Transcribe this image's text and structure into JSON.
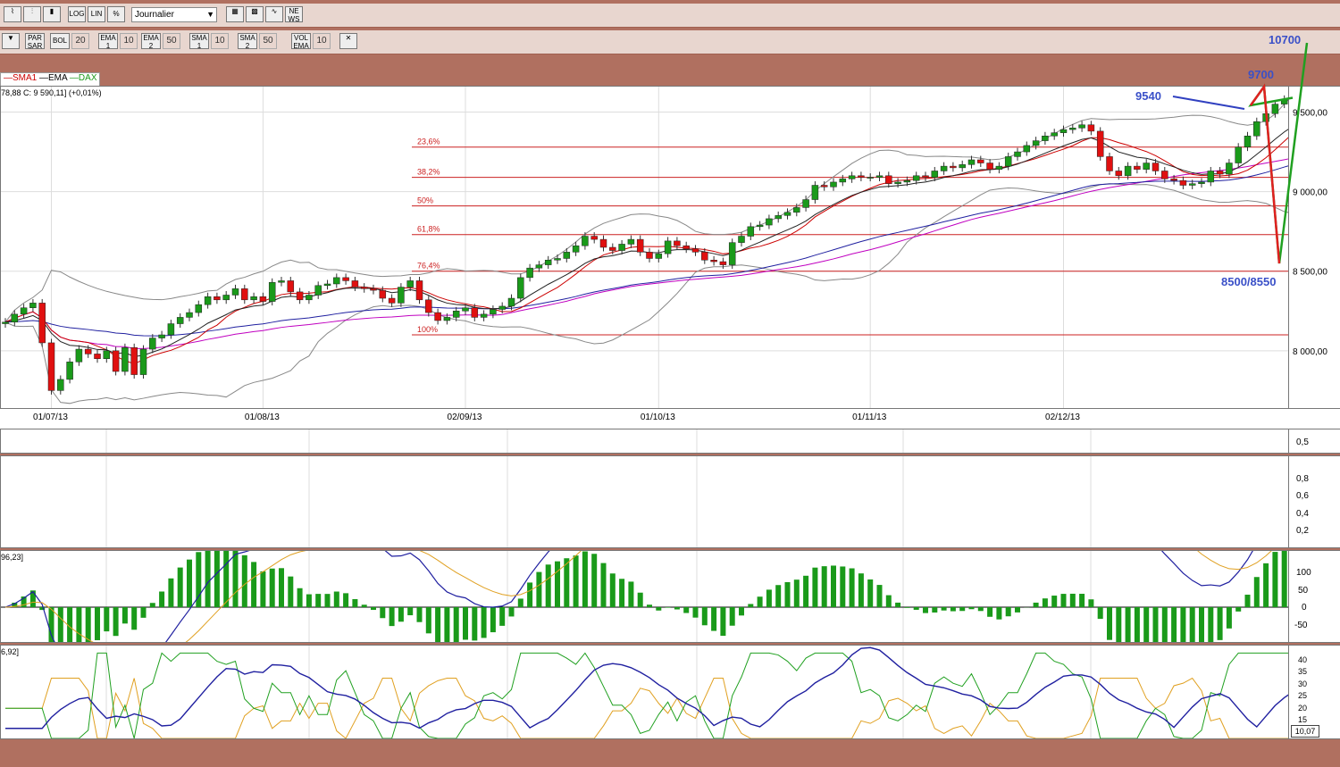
{
  "toolbar": {
    "period": "Journalier",
    "btn_log": "LOG",
    "btn_lin": "LIN",
    "btn_pct": "%",
    "btn_parsar": "PAR SAR",
    "btn_bol": "BOL",
    "bol_period": "20",
    "btn_ema1": "EMA 1",
    "ema1_period": "10",
    "btn_ema2": "EMA 2",
    "ema2_period": "50",
    "btn_sma1": "SMA 1",
    "sma1_period": "10",
    "btn_sma2": "SMA 2",
    "sma2_period": "50",
    "btn_vol": "VOL EMA",
    "vol_period": "10",
    "btn_news": "NE WS"
  },
  "legend": {
    "sma": "SMA1",
    "ema": "EMA",
    "dax": "DAX"
  },
  "info": "78,88  C: 9 590,11] (+0,01%)",
  "panel3_label": "96,23]",
  "panel4_label": "6,92]",
  "last_value": "10,07",
  "colors": {
    "up": "#1a9a1a",
    "down": "#e01010",
    "bg": "#b07060",
    "fib": "#cc2020",
    "ema": "#2020a0",
    "sma": "#c000c0"
  },
  "chart_data": {
    "type": "candlestick",
    "series_name": "DAX",
    "x_ticks": [
      {
        "label": "01/07/13",
        "day": 5
      },
      {
        "label": "01/08/13",
        "day": 28
      },
      {
        "label": "02/09/13",
        "day": 50
      },
      {
        "label": "01/10/13",
        "day": 71
      },
      {
        "label": "01/11/13",
        "day": 94
      },
      {
        "label": "02/12/13",
        "day": 115
      }
    ],
    "y_ticks": [
      {
        "label": "8 000,00",
        "value": 8000
      },
      {
        "label": "8 500,00",
        "value": 8500
      },
      {
        "label": "9 000,00",
        "value": 9000
      },
      {
        "label": "9 500,00",
        "value": 9500
      }
    ],
    "ylim": [
      7640,
      9660
    ],
    "fib_levels": [
      {
        "label": "23,6%",
        "value": 9280
      },
      {
        "label": "38,2%",
        "value": 9090
      },
      {
        "label": "50%",
        "value": 8910
      },
      {
        "label": "61,8%",
        "value": 8730
      },
      {
        "label": "76,4%",
        "value": 8500
      },
      {
        "label": "100%",
        "value": 8100
      }
    ],
    "annotations": [
      {
        "text": "10700"
      },
      {
        "text": "9700"
      },
      {
        "text": "9540"
      },
      {
        "text": "8500/8550"
      }
    ],
    "closes": [
      8180,
      8230,
      8270,
      8300,
      8050,
      7750,
      7820,
      7930,
      8010,
      7980,
      7950,
      8000,
      7870,
      8020,
      7850,
      8010,
      8080,
      8100,
      8170,
      8210,
      8240,
      8290,
      8340,
      8320,
      8350,
      8390,
      8320,
      8340,
      8310,
      8430,
      8440,
      8370,
      8320,
      8350,
      8410,
      8420,
      8460,
      8440,
      8400,
      8390,
      8380,
      8330,
      8300,
      8400,
      8440,
      8320,
      8240,
      8190,
      8210,
      8250,
      8270,
      8210,
      8230,
      8260,
      8280,
      8330,
      8460,
      8520,
      8540,
      8570,
      8580,
      8620,
      8660,
      8720,
      8700,
      8650,
      8630,
      8670,
      8700,
      8620,
      8580,
      8610,
      8690,
      8660,
      8640,
      8620,
      8570,
      8560,
      8540,
      8680,
      8720,
      8780,
      8790,
      8830,
      8850,
      8870,
      8900,
      8950,
      9040,
      9030,
      9060,
      9080,
      9100,
      9090,
      9090,
      9100,
      9050,
      9060,
      9070,
      9100,
      9090,
      9130,
      9160,
      9150,
      9170,
      9200,
      9180,
      9140,
      9160,
      9220,
      9250,
      9290,
      9320,
      9350,
      9370,
      9390,
      9400,
      9420,
      9380,
      9220,
      9130,
      9100,
      9160,
      9140,
      9180,
      9130,
      9080,
      9070,
      9040,
      9050,
      9060,
      9130,
      9110,
      9180,
      9280,
      9350,
      9440,
      9490,
      9550,
      9580,
      9590
    ]
  }
}
